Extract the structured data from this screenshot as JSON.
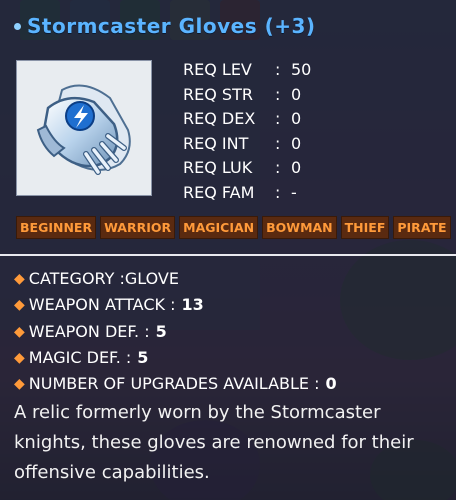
{
  "item": {
    "name": "Stormcaster Gloves (+3)",
    "icon": "glove-icon"
  },
  "requirements": [
    {
      "label": "REQ LEV",
      "value": "50"
    },
    {
      "label": "REQ STR",
      "value": "0"
    },
    {
      "label": "REQ DEX",
      "value": "0"
    },
    {
      "label": "REQ INT",
      "value": "0"
    },
    {
      "label": "REQ LUK",
      "value": "0"
    },
    {
      "label": "REQ FAM",
      "value": "-"
    }
  ],
  "jobs": [
    "BEGINNER",
    "WARRIOR",
    "MAGICIAN",
    "BOWMAN",
    "THIEF",
    "PIRATE"
  ],
  "stats": {
    "category": "CATEGORY :GLOVE",
    "weapon_attack_label": "WEAPON ATTACK :",
    "weapon_attack": "13",
    "weapon_def_label": "WEAPON DEF. :",
    "weapon_def": "5",
    "magic_def_label": "MAGIC DEF. :",
    "magic_def": "5",
    "upgrades_label": "NUMBER OF UPGRADES AVAILABLE :",
    "upgrades": "0"
  },
  "description": "A relic formerly worn by the Stormcaster knights, these gloves are renowned for their offensive capabilities.",
  "colors": {
    "title": "#5bb4ff",
    "job_text": "#ff9a3a",
    "job_bg": "#5a2a10"
  }
}
